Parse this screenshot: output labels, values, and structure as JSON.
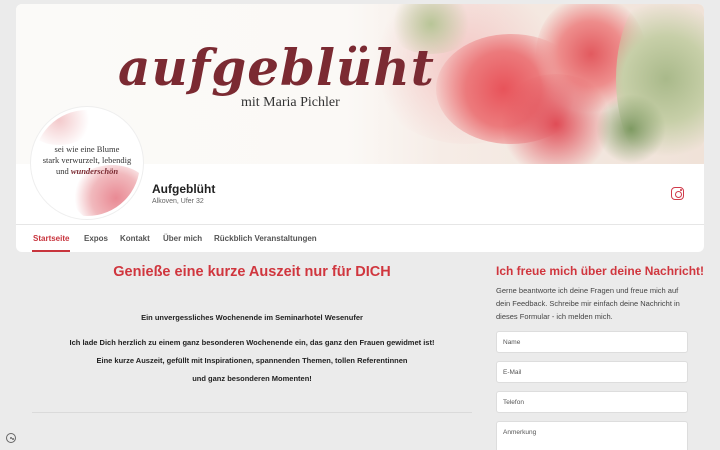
{
  "cover": {
    "title": "aufgeblüht",
    "subtitle": "mit Maria Pichler"
  },
  "avatar": {
    "lines": [
      "sei wie eine Blume",
      "stark verwurzelt, lebendig",
      "und",
      "wunderschön"
    ]
  },
  "profile": {
    "name": "Aufgeblüht",
    "location": "Alkoven, Ufer 32",
    "social_icon": "instagram-icon",
    "accent_color": "#d0363e"
  },
  "tabs": [
    "Startseite",
    "Expos",
    "Kontakt",
    "Über mich",
    "Rückblich Veranstaltungen"
  ],
  "main": {
    "title": "Genieße eine kurze Auszeit nur für DICH",
    "lines": [
      "Ein unvergessliches Wochenende im Seminarhotel Wesenufer",
      "Ich lade Dich herzlich zu einem ganz besonderen Wochenende ein, das ganz den Frauen gewidmet ist!",
      "Eine kurze Auszeit, gefüllt mit Inspirationen, spannenden Themen, tollen Referentinnen",
      "und ganz besonderen Momenten!"
    ]
  },
  "form": {
    "title": "Ich freue mich über deine Nachricht!",
    "description": "Gerne beantworte ich deine Fragen und freue mich auf dein Feedback. Schreibe mir einfach deine Nachricht in dieses Formular - ich melden mich.",
    "name_placeholder": "Name",
    "email_placeholder": "E-Mail",
    "phone_placeholder": "Telefon",
    "message_placeholder": "Anmerkung"
  }
}
